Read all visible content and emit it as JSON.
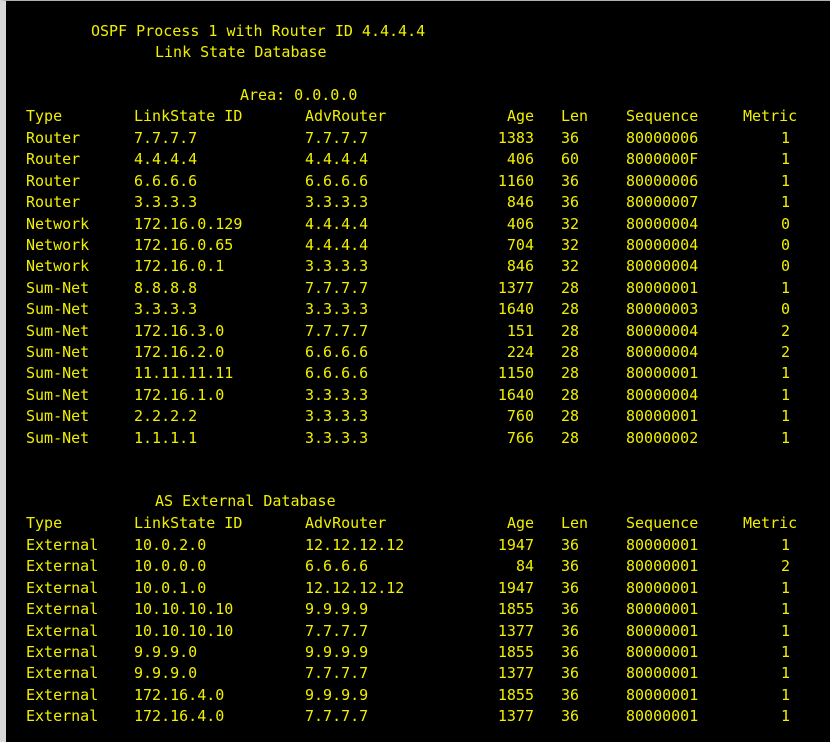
{
  "header": {
    "process_line": "OSPF Process 1 with Router ID 4.4.4.4",
    "db_title": "Link State Database"
  },
  "area": {
    "label": "Area: 0.0.0.0"
  },
  "columns": {
    "type": "Type",
    "lsid": "LinkState ID",
    "adv": "AdvRouter",
    "age": "Age",
    "len": "Len",
    "seq": "Sequence",
    "metric": "Metric"
  },
  "lsdb_rows": [
    {
      "type": "Router",
      "lsid": "7.7.7.7",
      "adv": "7.7.7.7",
      "age": "1383",
      "len": "36",
      "seq": "80000006",
      "metric": "1"
    },
    {
      "type": "Router",
      "lsid": "4.4.4.4",
      "adv": "4.4.4.4",
      "age": "406",
      "len": "60",
      "seq": "8000000F",
      "metric": "1"
    },
    {
      "type": "Router",
      "lsid": "6.6.6.6",
      "adv": "6.6.6.6",
      "age": "1160",
      "len": "36",
      "seq": "80000006",
      "metric": "1"
    },
    {
      "type": "Router",
      "lsid": "3.3.3.3",
      "adv": "3.3.3.3",
      "age": "846",
      "len": "36",
      "seq": "80000007",
      "metric": "1"
    },
    {
      "type": "Network",
      "lsid": "172.16.0.129",
      "adv": "4.4.4.4",
      "age": "406",
      "len": "32",
      "seq": "80000004",
      "metric": "0"
    },
    {
      "type": "Network",
      "lsid": "172.16.0.65",
      "adv": "4.4.4.4",
      "age": "704",
      "len": "32",
      "seq": "80000004",
      "metric": "0"
    },
    {
      "type": "Network",
      "lsid": "172.16.0.1",
      "adv": "3.3.3.3",
      "age": "846",
      "len": "32",
      "seq": "80000004",
      "metric": "0"
    },
    {
      "type": "Sum-Net",
      "lsid": "8.8.8.8",
      "adv": "7.7.7.7",
      "age": "1377",
      "len": "28",
      "seq": "80000001",
      "metric": "1"
    },
    {
      "type": "Sum-Net",
      "lsid": "3.3.3.3",
      "adv": "3.3.3.3",
      "age": "1640",
      "len": "28",
      "seq": "80000003",
      "metric": "0"
    },
    {
      "type": "Sum-Net",
      "lsid": "172.16.3.0",
      "adv": "7.7.7.7",
      "age": "151",
      "len": "28",
      "seq": "80000004",
      "metric": "2"
    },
    {
      "type": "Sum-Net",
      "lsid": "172.16.2.0",
      "adv": "6.6.6.6",
      "age": "224",
      "len": "28",
      "seq": "80000004",
      "metric": "2"
    },
    {
      "type": "Sum-Net",
      "lsid": "11.11.11.11",
      "adv": "6.6.6.6",
      "age": "1150",
      "len": "28",
      "seq": "80000001",
      "metric": "1"
    },
    {
      "type": "Sum-Net",
      "lsid": "172.16.1.0",
      "adv": "3.3.3.3",
      "age": "1640",
      "len": "28",
      "seq": "80000004",
      "metric": "1"
    },
    {
      "type": "Sum-Net",
      "lsid": "2.2.2.2",
      "adv": "3.3.3.3",
      "age": "760",
      "len": "28",
      "seq": "80000001",
      "metric": "1"
    },
    {
      "type": "Sum-Net",
      "lsid": "1.1.1.1",
      "adv": "3.3.3.3",
      "age": "766",
      "len": "28",
      "seq": "80000002",
      "metric": "1"
    }
  ],
  "external": {
    "title": "AS External Database"
  },
  "ext_rows": [
    {
      "type": "External",
      "lsid": "10.0.2.0",
      "adv": "12.12.12.12",
      "age": "1947",
      "len": "36",
      "seq": "80000001",
      "metric": "1"
    },
    {
      "type": "External",
      "lsid": "10.0.0.0",
      "adv": "6.6.6.6",
      "age": "84",
      "len": "36",
      "seq": "80000001",
      "metric": "2"
    },
    {
      "type": "External",
      "lsid": "10.0.1.0",
      "adv": "12.12.12.12",
      "age": "1947",
      "len": "36",
      "seq": "80000001",
      "metric": "1"
    },
    {
      "type": "External",
      "lsid": "10.10.10.10",
      "adv": "9.9.9.9",
      "age": "1855",
      "len": "36",
      "seq": "80000001",
      "metric": "1"
    },
    {
      "type": "External",
      "lsid": "10.10.10.10",
      "adv": "7.7.7.7",
      "age": "1377",
      "len": "36",
      "seq": "80000001",
      "metric": "1"
    },
    {
      "type": "External",
      "lsid": "9.9.9.0",
      "adv": "9.9.9.9",
      "age": "1855",
      "len": "36",
      "seq": "80000001",
      "metric": "1"
    },
    {
      "type": "External",
      "lsid": "9.9.9.0",
      "adv": "7.7.7.7",
      "age": "1377",
      "len": "36",
      "seq": "80000001",
      "metric": "1"
    },
    {
      "type": "External",
      "lsid": "172.16.4.0",
      "adv": "9.9.9.9",
      "age": "1855",
      "len": "36",
      "seq": "80000001",
      "metric": "1"
    },
    {
      "type": "External",
      "lsid": "172.16.4.0",
      "adv": "7.7.7.7",
      "age": "1377",
      "len": "36",
      "seq": "80000001",
      "metric": "1"
    }
  ],
  "colors": {
    "text": "#f0f000",
    "background": "#000000"
  }
}
